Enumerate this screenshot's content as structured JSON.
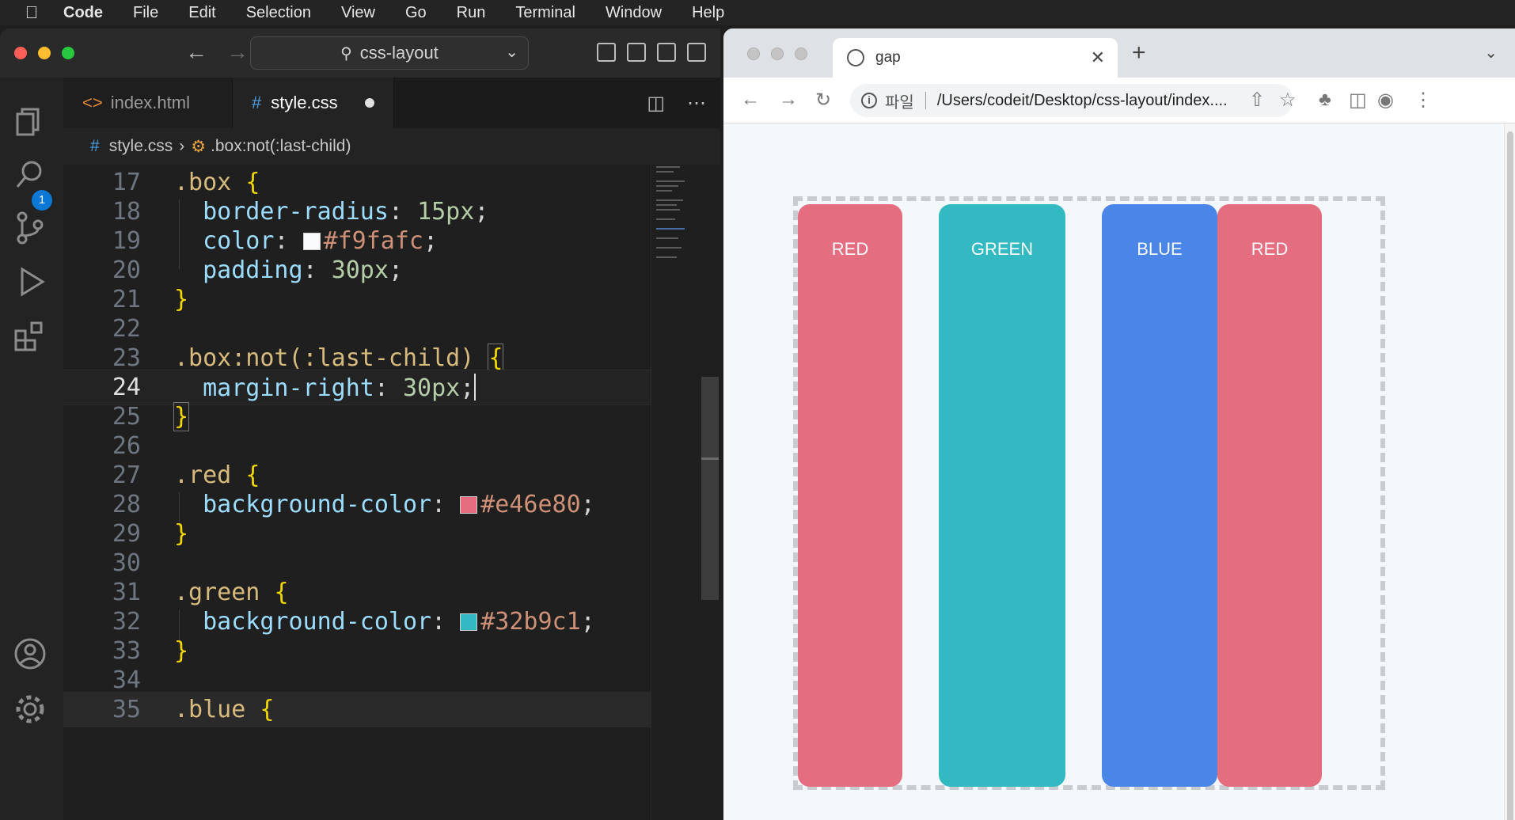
{
  "menubar": {
    "app": "Code",
    "items": [
      "File",
      "Edit",
      "Selection",
      "View",
      "Go",
      "Run",
      "Terminal",
      "Window",
      "Help"
    ]
  },
  "vscode": {
    "command_center": "css-layout",
    "tabs": [
      {
        "label": "index.html",
        "icon": "html-file-icon",
        "active": false
      },
      {
        "label": "style.css",
        "icon": "css-hash-icon",
        "active": true,
        "modified": true
      }
    ],
    "badge_count": "1",
    "breadcrumb": {
      "file": "style.css",
      "symbol": ".box:not(:last-child)"
    },
    "current_line": 24,
    "lines": [
      {
        "n": "17",
        "text": ".box {"
      },
      {
        "n": "18",
        "text": "  border-radius: 15px;"
      },
      {
        "n": "19",
        "text": "  color: #f9fafc;"
      },
      {
        "n": "20",
        "text": "  padding: 30px;"
      },
      {
        "n": "21",
        "text": "}"
      },
      {
        "n": "22",
        "text": ""
      },
      {
        "n": "23",
        "text": ".box:not(:last-child) {"
      },
      {
        "n": "24",
        "text": "  margin-right: 30px;"
      },
      {
        "n": "25",
        "text": "}"
      },
      {
        "n": "26",
        "text": ""
      },
      {
        "n": "27",
        "text": ".red {"
      },
      {
        "n": "28",
        "text": "  background-color: #e46e80;"
      },
      {
        "n": "29",
        "text": "}"
      },
      {
        "n": "30",
        "text": ""
      },
      {
        "n": "31",
        "text": ".green {"
      },
      {
        "n": "32",
        "text": "  background-color: #32b9c1;"
      },
      {
        "n": "33",
        "text": "}"
      },
      {
        "n": "34",
        "text": ""
      },
      {
        "n": "35",
        "text": ".blue {"
      }
    ],
    "colors": {
      "f9fafc": "#f9fafc",
      "red": "#e46e80",
      "green": "#32b9c1"
    }
  },
  "browser": {
    "tab_title": "gap",
    "address_label": "파일",
    "address": "/Users/codeit/Desktop/css-layout/index....",
    "boxes": [
      {
        "label": "RED",
        "color": "#e46e80"
      },
      {
        "label": "GREEN",
        "color": "#32b9c1"
      },
      {
        "label": "BLUE",
        "color": "#4a86e8"
      },
      {
        "label": "RED",
        "color": "#e46e80"
      }
    ]
  }
}
